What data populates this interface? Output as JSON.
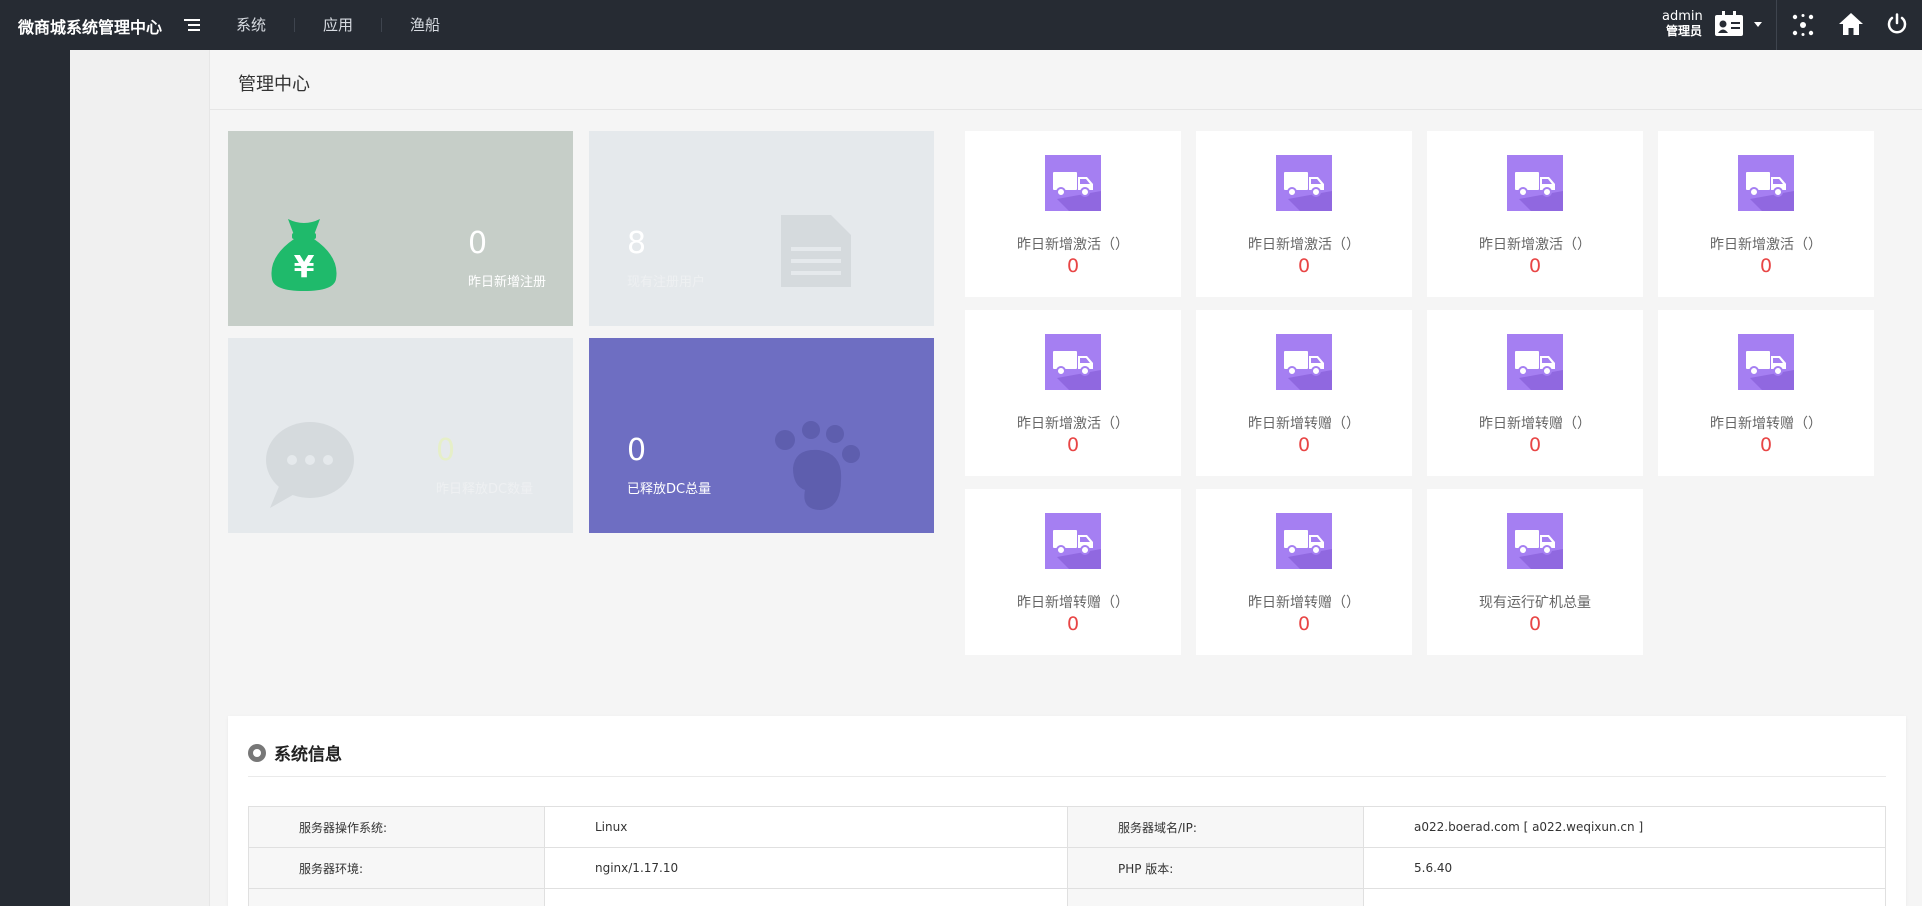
{
  "app": {
    "title": "微商城系统管理中心"
  },
  "nav": [
    "系统",
    "应用",
    "渔船"
  ],
  "user": {
    "name": "admin",
    "role": "管理员"
  },
  "icons": [
    "menu-icon",
    "id-card-icon",
    "network-icon",
    "home-icon",
    "power-icon"
  ],
  "breadcrumb": "管理中心",
  "stats": [
    {
      "value": "0",
      "label": "昨日新增注册",
      "icon": "money-bag-icon",
      "bg": "#c6cec8",
      "accent": "#1fba6b"
    },
    {
      "value": "8",
      "label": "现有注册用户",
      "icon": "document-icon",
      "bg": "#e5e9ec",
      "accent": "#d5dadd"
    },
    {
      "value": "0",
      "label": "昨日释放DC数量",
      "icon": "chat-bubble-icon",
      "bg": "#e5e9ec",
      "accent": "#d5dadd"
    },
    {
      "value": "0",
      "label": "已释放DC总量",
      "icon": "paw-icon",
      "bg": "#6e6ec2",
      "accent": "#5e5eae"
    }
  ],
  "mini_cards": [
    {
      "label": "昨日新增激活（）",
      "value": "0"
    },
    {
      "label": "昨日新增激活（）",
      "value": "0"
    },
    {
      "label": "昨日新增激活（）",
      "value": "0"
    },
    {
      "label": "昨日新增激活（）",
      "value": "0"
    },
    {
      "label": "昨日新增激活（）",
      "value": "0"
    },
    {
      "label": "昨日新增转赠（）",
      "value": "0"
    },
    {
      "label": "昨日新增转赠（）",
      "value": "0"
    },
    {
      "label": "昨日新增转赠（）",
      "value": "0"
    },
    {
      "label": "昨日新增转赠（）",
      "value": "0"
    },
    {
      "label": "昨日新增转赠（）",
      "value": "0"
    },
    {
      "label": "现有运行矿机总量",
      "value": "0"
    }
  ],
  "system_info": {
    "title": "系统信息",
    "rows": [
      [
        "服务器操作系统:",
        "Linux",
        "服务器域名/IP:",
        "a022.boerad.com [ a022.weqixun.cn ]"
      ],
      [
        "服务器环境:",
        "nginx/1.17.10",
        "PHP 版本:",
        "5.6.40"
      ]
    ]
  },
  "colors": {
    "topbar": "#262b33",
    "mini_icon": "#a57ff2",
    "value_red": "#e84545"
  }
}
